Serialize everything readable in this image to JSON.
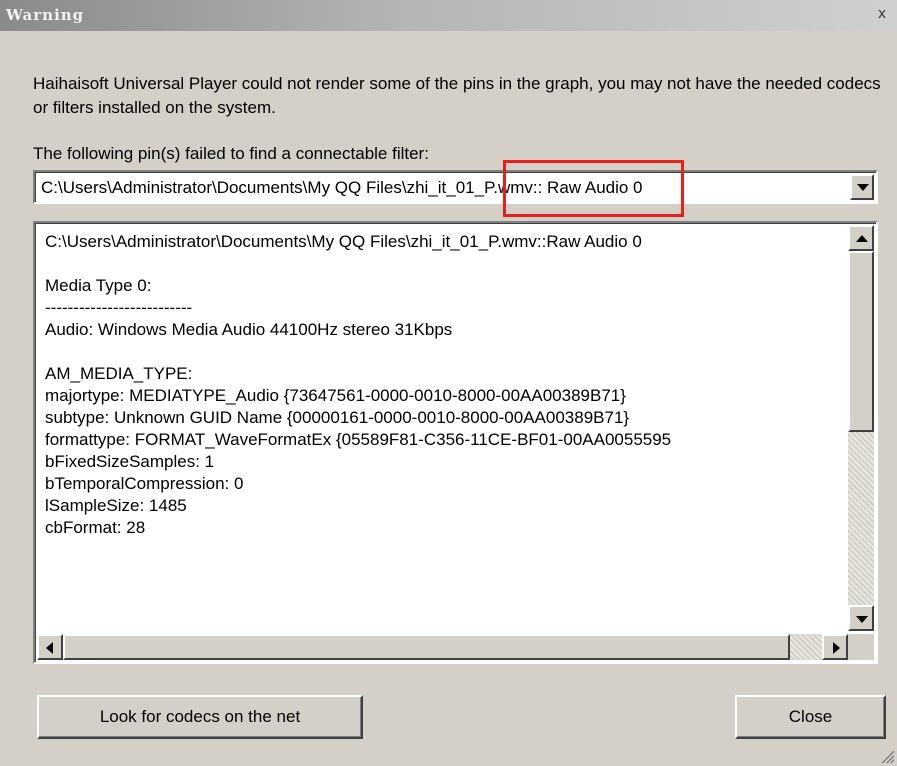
{
  "window": {
    "title": "Warning",
    "close_glyph": "x"
  },
  "message": "Haihaisoft Universal Player could not render some of the pins in the graph, you may not have the needed codecs or filters installed on the system.",
  "pins_label": "The following pin(s) failed to find a connectable filter:",
  "pin_select": {
    "value": "C:\\Users\\Administrator\\Documents\\My QQ Files\\zhi_it_01_P.wmv:: Raw Audio 0"
  },
  "details": {
    "lines": [
      "C:\\Users\\Administrator\\Documents\\My QQ Files\\zhi_it_01_P.wmv::Raw Audio 0",
      "",
      "Media Type 0:",
      "--------------------------",
      "Audio: Windows Media Audio 44100Hz stereo 31Kbps",
      "",
      "AM_MEDIA_TYPE:",
      "majortype: MEDIATYPE_Audio {73647561-0000-0010-8000-00AA00389B71}",
      "subtype: Unknown GUID Name {00000161-0000-0010-8000-00AA00389B71}",
      "formattype: FORMAT_WaveFormatEx {05589F81-C356-11CE-BF01-00AA0055595",
      "bFixedSizeSamples: 1",
      "bTemporalCompression: 0",
      "lSampleSize: 1485",
      "cbFormat: 28"
    ]
  },
  "buttons": {
    "look_for_codecs": "Look for codecs on the net",
    "close": "Close"
  },
  "icons": {
    "close": "close-icon",
    "dropdown": "chevron-down-icon",
    "scroll_up": "arrow-up-icon",
    "scroll_down": "arrow-down-icon",
    "scroll_left": "arrow-left-icon",
    "scroll_right": "arrow-right-icon",
    "grip": "resize-grip-icon"
  },
  "colors": {
    "dialog_bg": "#d4d0c8",
    "highlight_box": "#e8201a"
  }
}
